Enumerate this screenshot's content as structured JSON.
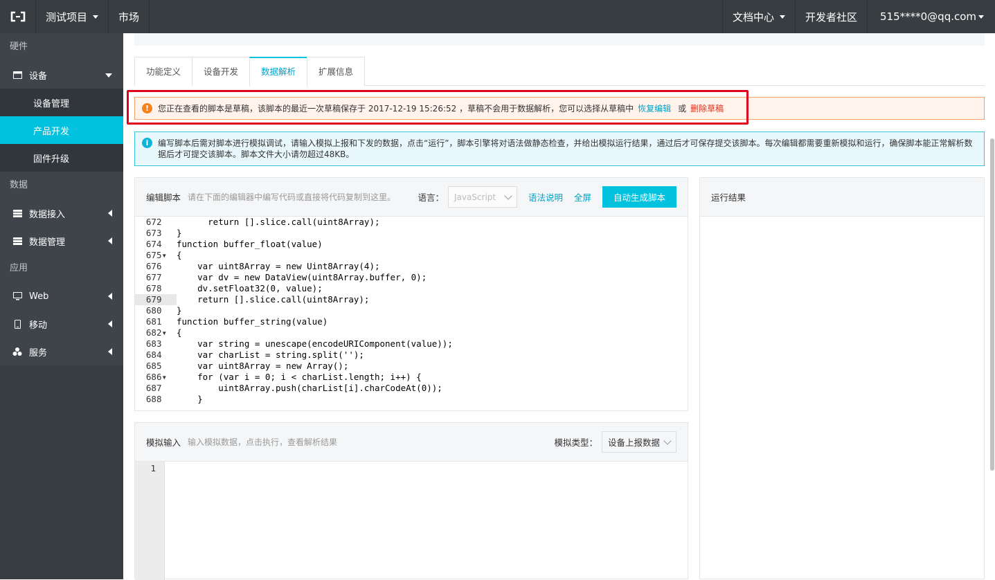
{
  "topbar": {
    "project": "测试项目",
    "market": "市场",
    "docs": "文档中心",
    "community": "开发者社区",
    "account": "515****0@qq.com"
  },
  "sidebar": {
    "group_hardware": "硬件",
    "device": "设备",
    "device_manage": "设备管理",
    "product_dev": "产品开发",
    "firmware": "固件升级",
    "group_data": "数据",
    "data_ingest": "数据接入",
    "data_manage": "数据管理",
    "group_app": "应用",
    "web": "Web",
    "mobile": "移动",
    "service": "服务"
  },
  "tabs": [
    "功能定义",
    "设备开发",
    "数据解析",
    "扩展信息"
  ],
  "warning": {
    "text": "您正在查看的脚本是草稿，该脚本的最近一次草稿保存于 2017-12-19 15:26:52 ，草稿不会用于数据解析，您可以选择从草稿中",
    "restore": "恢复编辑",
    "or": "或",
    "delete": "删除草稿"
  },
  "info": {
    "text": "编写脚本后需对脚本进行模拟调试，请输入模拟上报和下发的数据，点击“运行”，脚本引擎将对语法做静态检查，并给出模拟运行结果，通过后才可保存提交该脚本。每次编辑都需要重新模拟和运行，确保脚本能正常解析数据后才可提交该脚本。脚本文件大小请勿超过48KB。"
  },
  "editor": {
    "title": "编辑脚本",
    "hint": "请在下面的编辑器中编写代码或直接将代码复制到这里。",
    "lang_label": "语言：",
    "lang_value": "JavaScript",
    "syntax_link": "语法说明",
    "fullscreen": "全屏",
    "generate_btn": "自动生成脚本"
  },
  "code_lines": [
    {
      "n": "672",
      "t": "      return [].slice.call(uint8Array);"
    },
    {
      "n": "673",
      "t": "}"
    },
    {
      "n": "674",
      "t": "function buffer_float(value)"
    },
    {
      "n": "675",
      "t": "{"
    },
    {
      "n": "676",
      "t": "    var uint8Array = new Uint8Array(4);"
    },
    {
      "n": "677",
      "t": "    var dv = new DataView(uint8Array.buffer, 0);"
    },
    {
      "n": "678",
      "t": "    dv.setFloat32(0, value);"
    },
    {
      "n": "679",
      "t": "    return [].slice.call(uint8Array);"
    },
    {
      "n": "680",
      "t": "}"
    },
    {
      "n": "681",
      "t": "function buffer_string(value)"
    },
    {
      "n": "682",
      "t": "{"
    },
    {
      "n": "683",
      "t": "    var string = unescape(encodeURIComponent(value));"
    },
    {
      "n": "684",
      "t": "    var charList = string.split('');"
    },
    {
      "n": "685",
      "t": "    var uint8Array = new Array();"
    },
    {
      "n": "686",
      "t": "    for (var i = 0; i < charList.length; i++) {"
    },
    {
      "n": "687",
      "t": "        uint8Array.push(charList[i].charCodeAt(0));"
    },
    {
      "n": "688",
      "t": "    }"
    }
  ],
  "simulate": {
    "title": "模拟输入",
    "hint": "输入模拟数据，点击执行，查看解析结果",
    "type_label": "模拟类型：",
    "type_value": "设备上报数据",
    "line1": "1"
  },
  "result": {
    "title": "运行结果"
  }
}
